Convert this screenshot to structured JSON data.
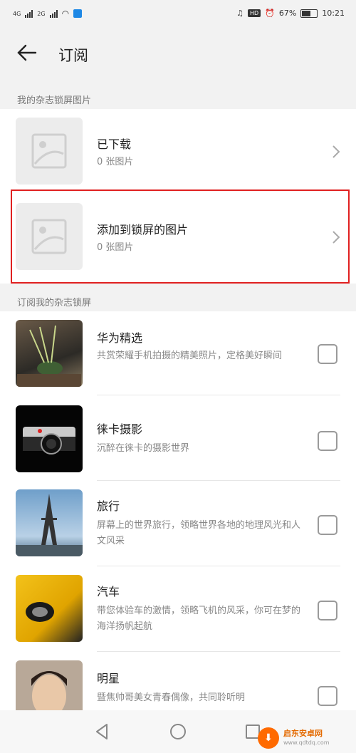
{
  "status_bar": {
    "network_1": "4G",
    "network_2": "2G",
    "hd": "HD",
    "battery": "67%",
    "time": "10:21"
  },
  "header": {
    "title": "订阅"
  },
  "section_mine": {
    "label": "我的杂志锁屏图片"
  },
  "mine_items": [
    {
      "title": "已下载",
      "subtitle": "0 张图片"
    },
    {
      "title": "添加到锁屏的图片",
      "subtitle": "0 张图片"
    }
  ],
  "section_subscribe": {
    "label": "订阅我的杂志锁屏"
  },
  "subscribe_items": [
    {
      "title": "华为精选",
      "subtitle": "共赏荣耀手机拍摄的精美照片，定格美好瞬间",
      "checked": false
    },
    {
      "title": "徕卡摄影",
      "subtitle": "沉醉在徕卡的摄影世界",
      "checked": false
    },
    {
      "title": "旅行",
      "subtitle": "屏幕上的世界旅行，领略世界各地的地理风光和人文风采",
      "checked": false
    },
    {
      "title": "汽车",
      "subtitle": "带您体验车的激情，领略飞机的风采，你可在梦的海洋扬帆起航",
      "checked": false
    },
    {
      "title": "明星",
      "subtitle": "暨焦帅哥美女青春偶像，共同聆听明",
      "checked": false
    }
  ],
  "watermark": {
    "name": "启东安卓网",
    "url": "www.qdtdq.com"
  },
  "colors": {
    "highlight": "#e02020",
    "accent": "#1e88e5"
  }
}
